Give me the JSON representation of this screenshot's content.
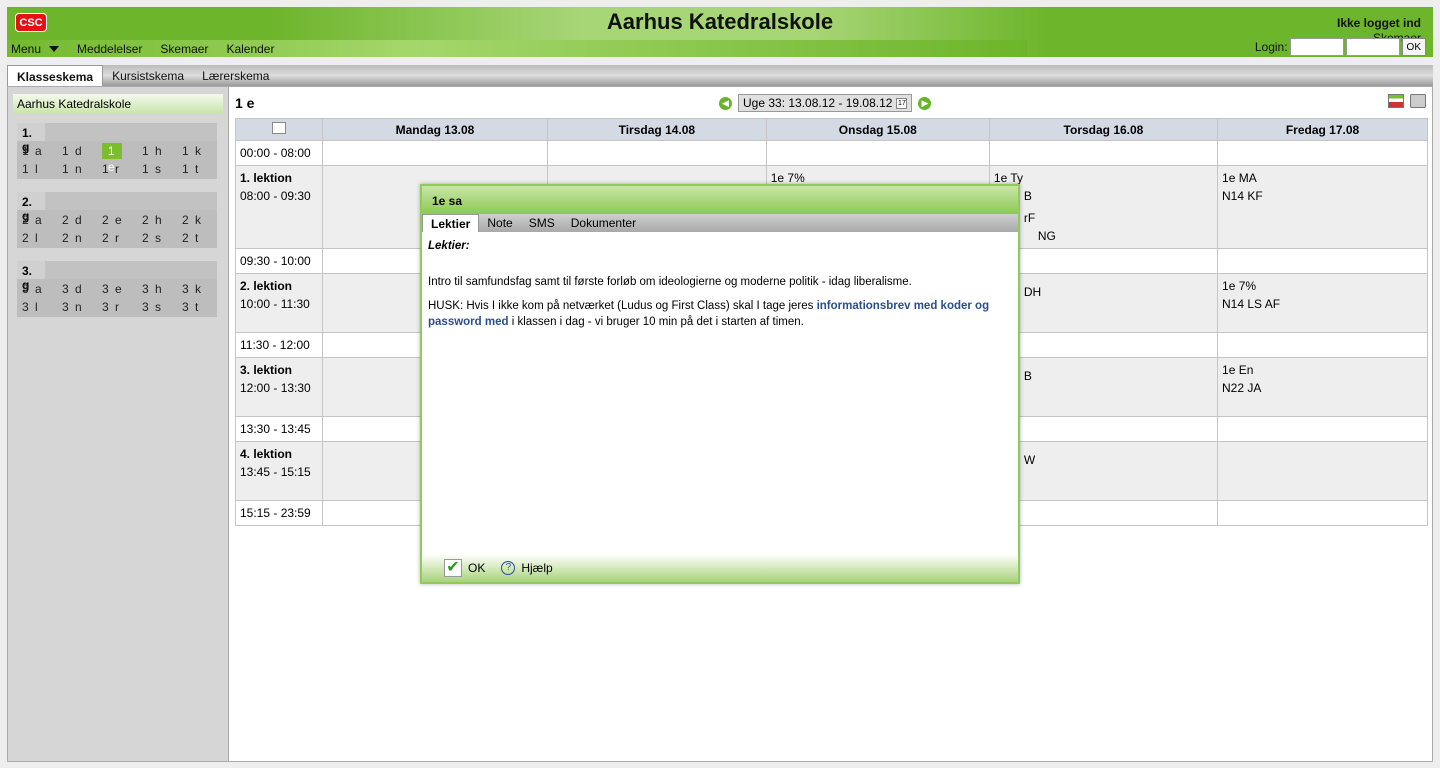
{
  "header": {
    "logo": "CSC",
    "title": "Aarhus Katedralskole",
    "status": "Ikke logget ind",
    "skemaer_link": "Skemaer",
    "nav": [
      "Menu",
      "Meddelelser",
      "Skemaer",
      "Kalender"
    ],
    "login_label": "Login:",
    "login_ok": "OK"
  },
  "tabs": [
    "Klasseskema",
    "Kursistskema",
    "Lærerskema"
  ],
  "sidebar": {
    "school": "Aarhus Katedralskole",
    "groups": [
      {
        "label": "1. g",
        "classes": [
          "1 a",
          "1 d",
          "1 e",
          "1 h",
          "1 k",
          "1 l",
          "1 n",
          "1 r",
          "1 s",
          "1 t"
        ]
      },
      {
        "label": "2. g",
        "classes": [
          "2 a",
          "2 d",
          "2 e",
          "2 h",
          "2 k",
          "2 l",
          "2 n",
          "2 r",
          "2 s",
          "2 t"
        ]
      },
      {
        "label": "3. g",
        "classes": [
          "3 a",
          "3 d",
          "3 e",
          "3 h",
          "3 k",
          "3 l",
          "3 n",
          "3 r",
          "3 s",
          "3 t"
        ]
      }
    ],
    "selected": "1 e"
  },
  "schedule": {
    "class_name": "1 e",
    "week": "Uge 33: 13.08.12 - 19.08.12",
    "days": [
      "Mandag 13.08",
      "Tirsdag 14.08",
      "Onsdag 15.08",
      "Torsdag 16.08",
      "Fredag 17.08"
    ],
    "rows": [
      {
        "type": "free",
        "time": "00:00 - 08:00"
      },
      {
        "type": "lesson",
        "label": "1. lektion",
        "time": "08:00 - 09:30",
        "cells": [
          "",
          "",
          "1e 7%",
          "1e Ty",
          "1e MA\nN14 KF"
        ]
      },
      {
        "type": "free",
        "time": "09:30 - 10:00"
      },
      {
        "type": "lesson",
        "label": "2. lektion",
        "time": "10:00 - 11:30",
        "cells": [
          "",
          "",
          "",
          "",
          "1e 7%\nN14 LS AF"
        ]
      },
      {
        "type": "free",
        "time": "11:30 - 12:00"
      },
      {
        "type": "lesson",
        "label": "3. lektion",
        "time": "12:00 - 13:30",
        "cells": [
          "",
          "",
          "",
          "",
          "1e En\nN22 JA"
        ]
      },
      {
        "type": "free",
        "time": "13:30 - 13:45"
      },
      {
        "type": "lesson",
        "label": "4. lektion",
        "time": "13:45 - 15:15",
        "cells": [
          "",
          "",
          "",
          "",
          ""
        ]
      },
      {
        "type": "free",
        "time": "15:15 - 23:59"
      }
    ],
    "partial_visible": {
      "thu_l1_a": "B",
      "thu_l1_b": "rF",
      "thu_l1_c": "NG",
      "thu_l2": "DH",
      "thu_l3": "B",
      "thu_l4": "W"
    }
  },
  "dialog": {
    "title": "1e sa",
    "tabs": [
      "Lektier",
      "Note",
      "SMS",
      "Dokumenter"
    ],
    "heading": "Lektier:",
    "paragraph1": "Intro til samfundsfag samt til første forløb om ideologierne og moderne politik - idag liberalisme.",
    "paragraph2_pre": "HUSK: Hvis I ikke kom på netværket (Ludus og First Class) skal I tage jeres ",
    "paragraph2_link": "informationsbrev med koder og password med",
    "paragraph2_post": " i klassen i dag - vi bruger 10 min på det i starten af timen.",
    "ok": "OK",
    "help": "Hjælp"
  }
}
